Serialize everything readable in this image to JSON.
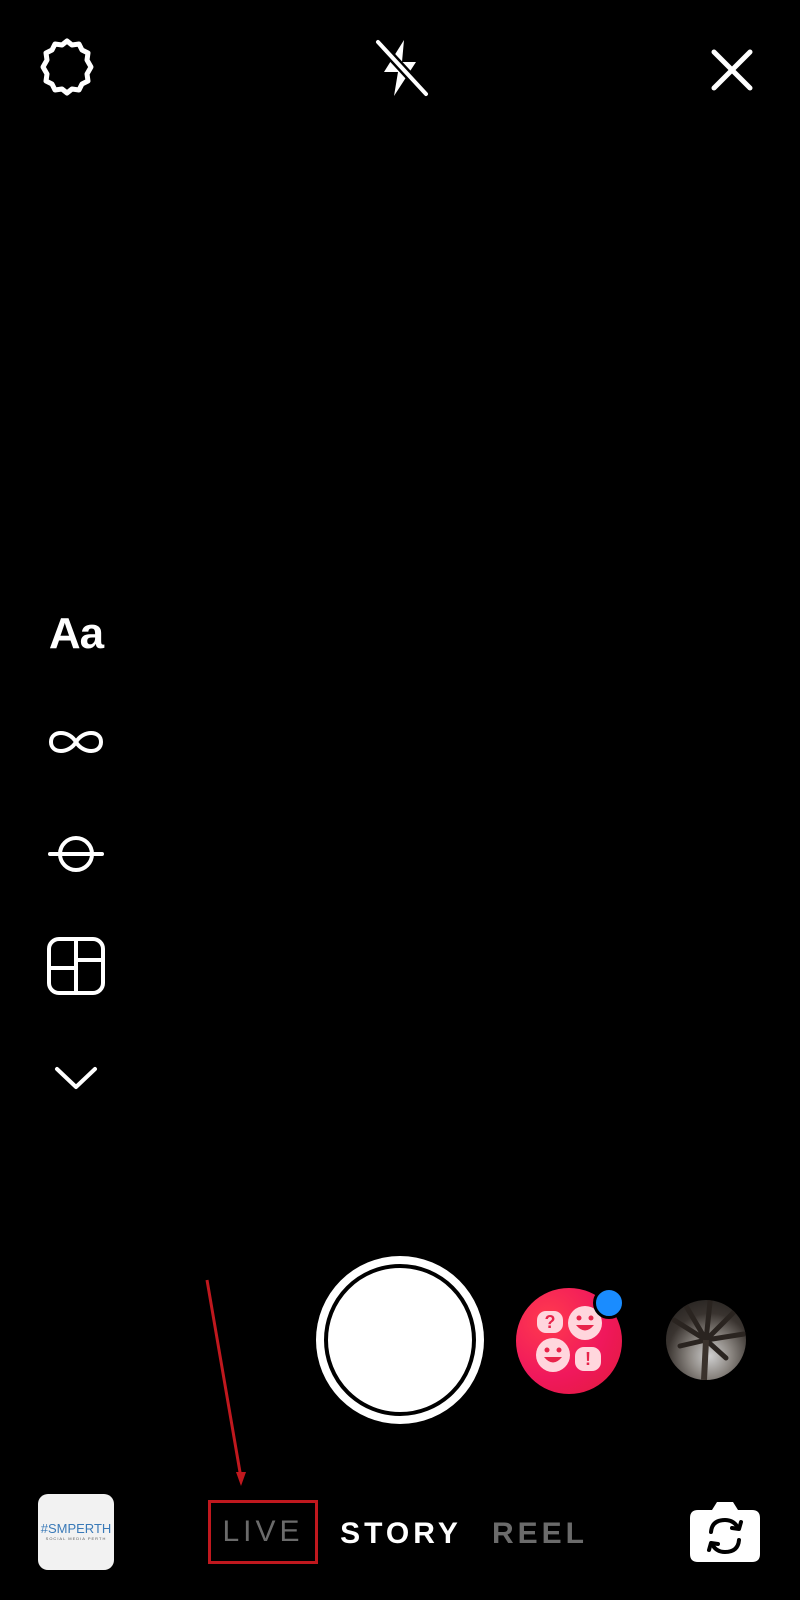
{
  "top_bar": {
    "settings_icon": "gear-icon",
    "flash_icon": "flash-off-icon",
    "close_icon": "close-icon"
  },
  "tools": {
    "text_label": "Aa",
    "boomerang_icon": "infinity-icon",
    "level_icon": "level-icon",
    "layout_icon": "layout-icon",
    "more_icon": "chevron-down-icon"
  },
  "camera": {
    "shutter_icon": "shutter-button",
    "effect_icon": "quiz-effect-icon",
    "effect_badge_color": "#1a8cff",
    "gallery_recent_icon": "palm-photo-thumbnail"
  },
  "bottom": {
    "gallery_logo": "#SMPERTH",
    "gallery_sub": "SOCIAL MEDIA PERTH",
    "modes": {
      "live": "LIVE",
      "story": "STORY",
      "reel": "REEL"
    },
    "selected_mode": "STORY",
    "flip_icon": "camera-flip-icon"
  },
  "colors": {
    "background": "#000000",
    "inactive_mode": "#6b6b6b",
    "annotation": "#c0181e"
  }
}
